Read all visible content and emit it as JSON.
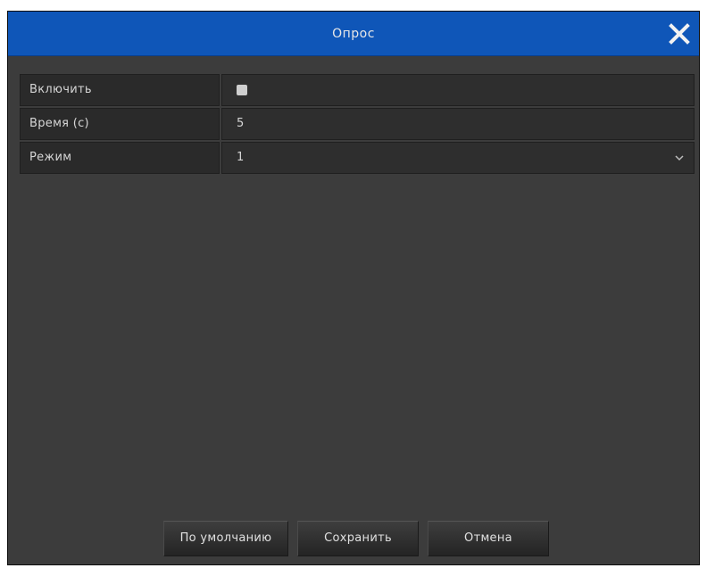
{
  "dialog": {
    "title": "Опрос"
  },
  "settings": {
    "enable": {
      "label": "Включить",
      "checked": false
    },
    "time": {
      "label": "Время (с)",
      "value": "5"
    },
    "mode": {
      "label": "Режим",
      "value": "1"
    }
  },
  "buttons": {
    "default_label": "По умолчанию",
    "save_label": "Сохранить",
    "cancel_label": "Отмена"
  },
  "icons": {
    "close": "close-icon",
    "dropdown": "chevron-down-icon"
  },
  "colors": {
    "titlebar": "#0f56b8",
    "body": "#3c3c3c",
    "checkbox": "#cfcfcf"
  }
}
